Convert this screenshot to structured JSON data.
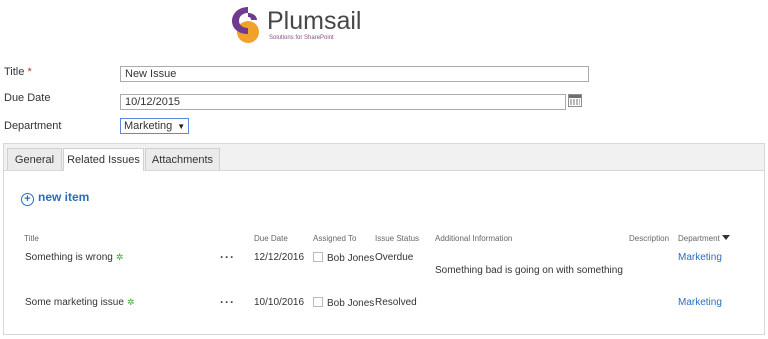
{
  "logo": {
    "brand": "Plumsail",
    "tagline": "Solutions for SharePoint",
    "colors": {
      "purple": "#6f3a8f",
      "orange": "#f0a22a"
    }
  },
  "form": {
    "title_label": "Title",
    "required_mark": "*",
    "title_value": "New Issue",
    "due_date_label": "Due Date",
    "due_date_value": "10/12/2015",
    "department_label": "Department",
    "department_value": "Marketing"
  },
  "tabs": [
    {
      "label": "General"
    },
    {
      "label": "Related Issues"
    },
    {
      "label": "Attachments"
    }
  ],
  "active_tab": "Related Issues",
  "list": {
    "new_item_label": "new item",
    "columns": [
      "Title",
      "Due Date",
      "Assigned To",
      "Issue Status",
      "Additional Information",
      "Description",
      "Department"
    ],
    "rows": [
      {
        "title": "Something is wrong",
        "due_date": "12/12/2016",
        "assigned_to": "Bob Jones",
        "status": "Overdue",
        "additional_info": "Something bad is going on with something",
        "description": "",
        "department": "Marketing"
      },
      {
        "title": "Some marketing issue",
        "due_date": "10/10/2016",
        "assigned_to": "Bob Jones",
        "status": "Resolved",
        "additional_info": "",
        "description": "",
        "department": "Marketing"
      }
    ]
  },
  "icons": {
    "calendar": "calendar-icon",
    "new": "new-item-plus-icon",
    "filter": "filter-icon",
    "menu": "ellipsis-icon"
  },
  "colors": {
    "link": "#2a6ebb",
    "new_badge": "#3aa935"
  }
}
